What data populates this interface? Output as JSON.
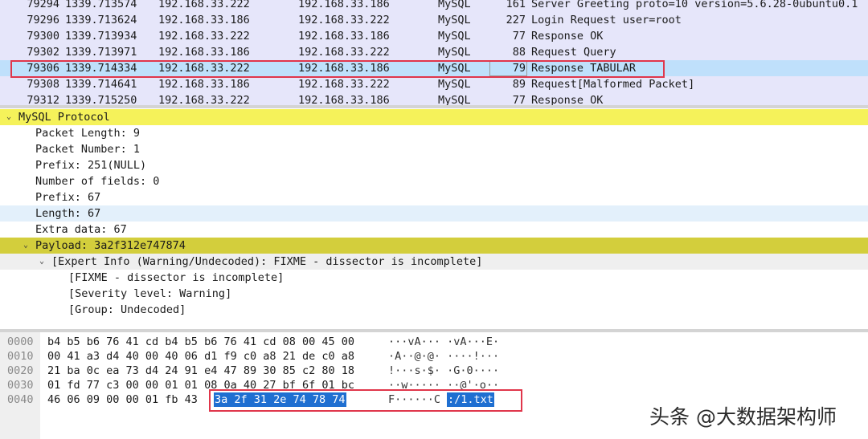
{
  "packet_list": {
    "rows": [
      {
        "no": "79294",
        "time": "1339.713574",
        "src": "192.168.33.222",
        "dst": "192.168.33.186",
        "proto": "MySQL",
        "len": "161",
        "info": "Server Greeting  proto=10 version=5.6.28-0ubuntu0.1"
      },
      {
        "no": "79296",
        "time": "1339.713624",
        "src": "192.168.33.186",
        "dst": "192.168.33.222",
        "proto": "MySQL",
        "len": "227",
        "info": "Login Request user=root"
      },
      {
        "no": "79300",
        "time": "1339.713934",
        "src": "192.168.33.222",
        "dst": "192.168.33.186",
        "proto": "MySQL",
        "len": "77",
        "info": "Response  OK"
      },
      {
        "no": "79302",
        "time": "1339.713971",
        "src": "192.168.33.186",
        "dst": "192.168.33.222",
        "proto": "MySQL",
        "len": "88",
        "info": "Request Query"
      },
      {
        "no": "79306",
        "time": "1339.714334",
        "src": "192.168.33.222",
        "dst": "192.168.33.186",
        "proto": "MySQL",
        "len": "79",
        "info": "Response TABULAR"
      },
      {
        "no": "79308",
        "time": "1339.714641",
        "src": "192.168.33.186",
        "dst": "192.168.33.222",
        "proto": "MySQL",
        "len": "89",
        "info": "Request[Malformed Packet]"
      },
      {
        "no": "79312",
        "time": "1339.715250",
        "src": "192.168.33.222",
        "dst": "192.168.33.186",
        "proto": "MySQL",
        "len": "77",
        "info": "Response  OK"
      }
    ]
  },
  "details": {
    "rows": [
      {
        "text": "MySQL Protocol",
        "arrow": "⌄"
      },
      {
        "text": "Packet Length: 9"
      },
      {
        "text": "Packet Number: 1"
      },
      {
        "text": "Prefix: 251(NULL)"
      },
      {
        "text": "Number of fields: 0"
      },
      {
        "text": "Prefix: 67"
      },
      {
        "text": "Length: 67"
      },
      {
        "text": "Extra data: 67"
      },
      {
        "text": "Payload: 3a2f312e747874",
        "arrow": "⌄"
      },
      {
        "text": "[Expert Info (Warning/Undecoded): FIXME - dissector is incomplete]",
        "arrow": "⌄"
      },
      {
        "text": "[FIXME - dissector is incomplete]"
      },
      {
        "text": "[Severity level: Warning]"
      },
      {
        "text": "[Group: Undecoded]"
      }
    ]
  },
  "hex_pane": {
    "rows": [
      {
        "offset": "0000",
        "bytes": "b4 b5 b6 76 41 cd b4 b5  b6 76 41 cd 08 00 45 00",
        "ascii": "···vA··· ·vA···E·"
      },
      {
        "offset": "0010",
        "bytes": "00 41 a3 d4 40 00 40 06  d1 f9 c0 a8 21 de c0 a8",
        "ascii": "·A··@·@· ····!···"
      },
      {
        "offset": "0020",
        "bytes": "21 ba 0c ea 73 d4 24 91  e4 47 89 30 85 c2 80 18",
        "ascii": "!···s·$· ·G·0····"
      },
      {
        "offset": "0030",
        "bytes": "01 fd 77 c3 00 00 01 01  08 0a 40 27 bf 6f 01 bc",
        "ascii": "··w····· ··@'·o··"
      },
      {
        "offset": "0040",
        "bytes": "46 06 09 00 00 01 fb 43",
        "sel_bytes": "3a 2f 31 2e 74 78 74",
        "ascii": "F······C",
        "sel_ascii": ":/1.txt"
      }
    ]
  },
  "watermark": "头条 @大数据架构师",
  "colors": {
    "packet_list_bg": "#e6e6fa",
    "selected_row": "#bfe0fb",
    "protocol_highlight": "#f5f25a",
    "payload_highlight": "#d3ce3c",
    "hex_selection": "#1f6fd1",
    "annotation_box": "#e0364b"
  }
}
